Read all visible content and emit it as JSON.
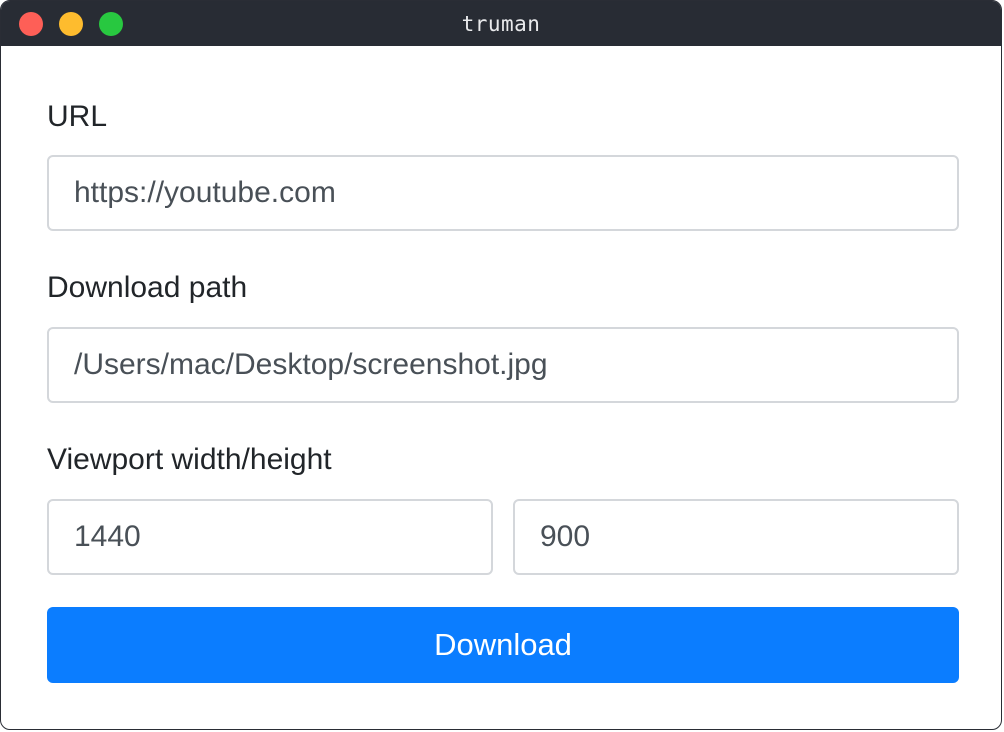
{
  "window": {
    "title": "truman",
    "controls": [
      "close",
      "minimize",
      "maximize"
    ]
  },
  "form": {
    "url": {
      "label": "URL",
      "value": "https://youtube.com"
    },
    "download_path": {
      "label": "Download path",
      "value": "/Users/mac/Desktop/screenshot.jpg"
    },
    "viewport": {
      "label": "Viewport width/height",
      "width": "1440",
      "height": "900"
    },
    "download_button": "Download"
  },
  "colors": {
    "titlebar": "#282c34",
    "close": "#fe5f57",
    "minimize": "#febc2e",
    "maximize": "#28c840",
    "accent": "#0b7dff",
    "input_border": "#d4d7db",
    "text": "#212529"
  }
}
